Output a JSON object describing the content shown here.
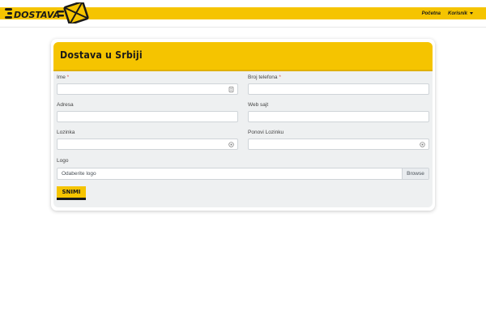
{
  "brand": {
    "name": "DOSTAVA"
  },
  "nav": {
    "home": "Početna",
    "user": "Korisnik"
  },
  "card": {
    "title": "Dostava u Srbiji"
  },
  "form": {
    "name_label": "Ime",
    "phone_label": "Broj telefona",
    "required_mark": "*",
    "address_label": "Adresa",
    "website_label": "Web sajt",
    "password_label": "Lozinka",
    "repeat_password_label": "Ponovi Lozinku",
    "logo_label": "Logo",
    "logo_placeholder": "Odaberite logo",
    "browse": "Browse",
    "save": "SNIMI"
  },
  "icons": {
    "name_field": "contact-card-icon",
    "password": "eye-icon"
  },
  "colors": {
    "brand_yellow": "#f5c400",
    "dark": "#1a1a1a",
    "body_bg": "#eef0f1"
  }
}
